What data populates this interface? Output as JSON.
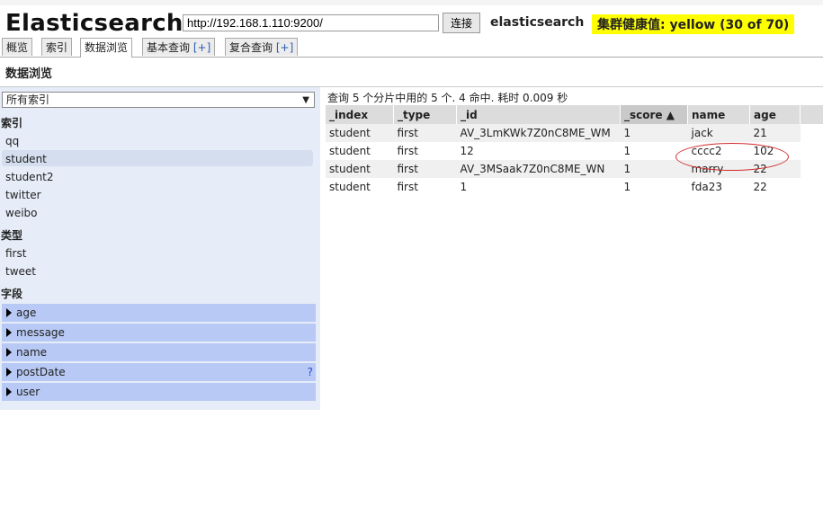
{
  "app": {
    "title": "Elasticsearch",
    "url": "http://192.168.1.110:9200/",
    "connect_label": "连接",
    "cluster_name": "elasticsearch",
    "health": "集群健康值: yellow (30 of 70)"
  },
  "tabs": [
    {
      "label": "概览",
      "plus": ""
    },
    {
      "label": "索引",
      "plus": ""
    },
    {
      "label": "数据浏览",
      "plus": ""
    },
    {
      "label": "基本查询",
      "plus": "[+]"
    },
    {
      "label": "复合查询",
      "plus": "[+]"
    }
  ],
  "page_title": "数据浏览",
  "sidebar": {
    "index_select": "所有索引",
    "indices_label": "索引",
    "indices": [
      "qq",
      "student",
      "student2",
      "twitter",
      "weibo"
    ],
    "types_label": "类型",
    "types": [
      "first",
      "tweet"
    ],
    "fields_label": "字段",
    "fields": [
      "age",
      "message",
      "name",
      "postDate",
      "user"
    ],
    "help_mark": "?"
  },
  "results": {
    "summary": "查询 5 个分片中用的 5 个. 4 命中. 耗时 0.009 秒",
    "columns": [
      "_index",
      "_type",
      "_id",
      "_score ▲",
      "name",
      "age"
    ],
    "rows": [
      [
        "student",
        "first",
        "AV_3LmKWk7Z0nC8ME_WM",
        "1",
        "jack",
        "21"
      ],
      [
        "student",
        "first",
        "12",
        "1",
        "cccc2",
        "102"
      ],
      [
        "student",
        "first",
        "AV_3MSaak7Z0nC8ME_WN",
        "1",
        "marry",
        "22"
      ],
      [
        "student",
        "first",
        "1",
        "1",
        "fda23",
        "22"
      ]
    ]
  },
  "colors": {
    "health_bg": "#ffff00",
    "field_bg": "#b7c9f4",
    "sidebar_bg": "#e6edf8",
    "annotation": "#d02b2b"
  }
}
